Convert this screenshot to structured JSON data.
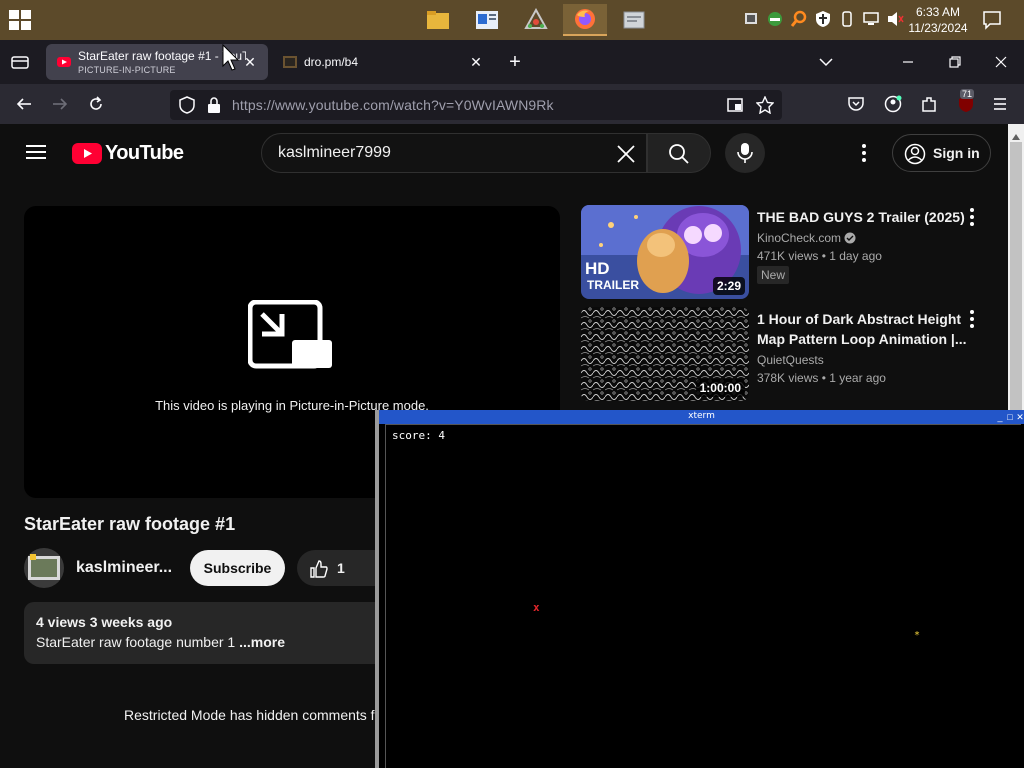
{
  "taskbar": {
    "clock_time": "6:33 AM",
    "clock_date": "11/23/2024",
    "pinned": [
      "file-explorer",
      "news",
      "app",
      "firefox",
      "app"
    ],
    "tray_icons": [
      "network-icon",
      "app-icon",
      "search-icon",
      "shield-icon",
      "usb-icon",
      "display-icon",
      "volume-muted-icon"
    ]
  },
  "browser": {
    "tabs": [
      {
        "title": "StarEater raw footage #1 - YouTube",
        "subtitle": "PICTURE-IN-PICTURE",
        "active": true
      },
      {
        "title": "dro.pm/b4",
        "active": false
      }
    ],
    "url": "https://www.youtube.com/watch?v=Y0WvIAWN9Rk",
    "extension_badge": "71"
  },
  "youtube": {
    "logo": "YouTube",
    "search_query": "kaslmineer7999",
    "sign_in": "Sign in",
    "pip_message": "This video is playing in Picture-in-Picture mode.",
    "video_title": "StarEater raw footage #1",
    "channel": "kaslmineer...",
    "subscribe": "Subscribe",
    "likes": "1",
    "desc_stats": "4 views  3 weeks ago",
    "desc_text": "StarEater raw footage number 1 ",
    "desc_more": "...more",
    "restricted": "Restricted Mode has hidden comments f",
    "recommendations": [
      {
        "title": "THE BAD GUYS 2 Trailer (2025)",
        "channel": "KinoCheck.com",
        "meta": "471K views  • 1 day ago",
        "badge": "New",
        "duration": "2:29",
        "thumb_text_1": "HD",
        "thumb_text_2": "TRAILER"
      },
      {
        "title": "1 Hour of Dark Abstract Height Map Pattern Loop Animation |...",
        "channel": "QuietQuests",
        "meta": "378K views  • 1 year ago",
        "duration": "1:00:00"
      }
    ]
  },
  "xterm": {
    "title": "xterm",
    "score_line": "score: 4",
    "enemy_char": "x",
    "star_char": "*"
  }
}
